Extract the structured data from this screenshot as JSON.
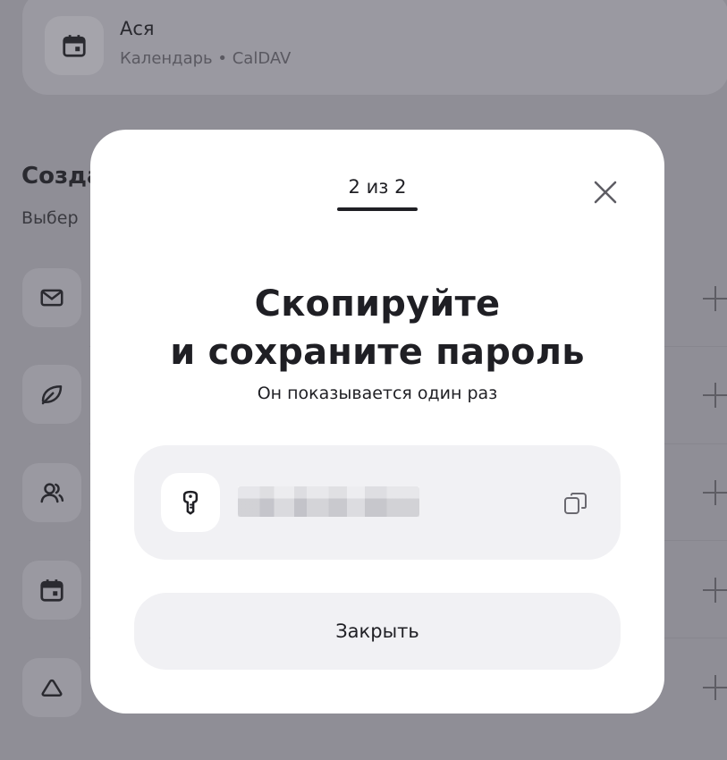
{
  "background": {
    "account_card": {
      "title": "Ася",
      "subtitle": "Календарь • CalDAV",
      "icon": "calendar-icon"
    },
    "section_heading": "Созда",
    "section_subheading": "Выбер",
    "rows": [
      {
        "icon": "mail-icon"
      },
      {
        "icon": "leaf-icon"
      },
      {
        "icon": "contacts-icon"
      },
      {
        "icon": "calendar-icon"
      },
      {
        "icon": "cloud-drive-icon"
      }
    ]
  },
  "modal": {
    "step": "2 из 2",
    "title_line1": "Скопируйте",
    "title_line2": "и сохраните пароль",
    "subtitle": "Он показывается один раз",
    "password_icon": "key-icon",
    "copy_icon": "copy-icon",
    "close_icon": "close-icon",
    "close_button": "Закрыть"
  },
  "colors": {
    "overlay": "#8f8e96",
    "modal_bg": "#ffffff",
    "field_bg": "#f1f1f4",
    "text": "#1f1f24"
  }
}
